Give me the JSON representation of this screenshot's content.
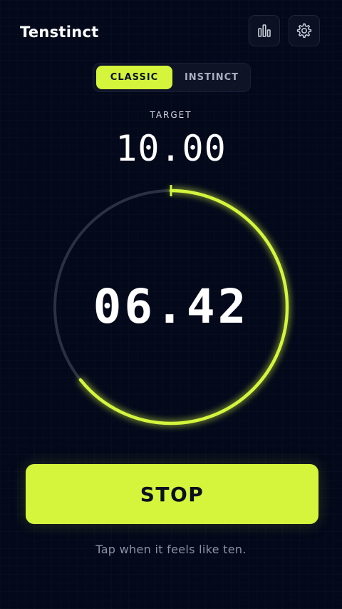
{
  "header": {
    "title": "Tenstinct",
    "stats_icon": "bar-chart-icon",
    "settings_icon": "gear-icon"
  },
  "mode_toggle": {
    "options": [
      {
        "label": "CLASSIC",
        "selected": true
      },
      {
        "label": "INSTINCT",
        "selected": false
      }
    ]
  },
  "target": {
    "label": "TARGET",
    "value": "10.00"
  },
  "timer": {
    "value": "06.42",
    "progress_fraction": 0.642
  },
  "actions": {
    "stop_label": "STOP"
  },
  "hint": "Tap when it feels like ten.",
  "colors": {
    "accent": "#d4f53c",
    "background": "#03081a",
    "ring_track": "#2a3142",
    "text": "#ffffff",
    "muted_text": "#8c93a6"
  }
}
